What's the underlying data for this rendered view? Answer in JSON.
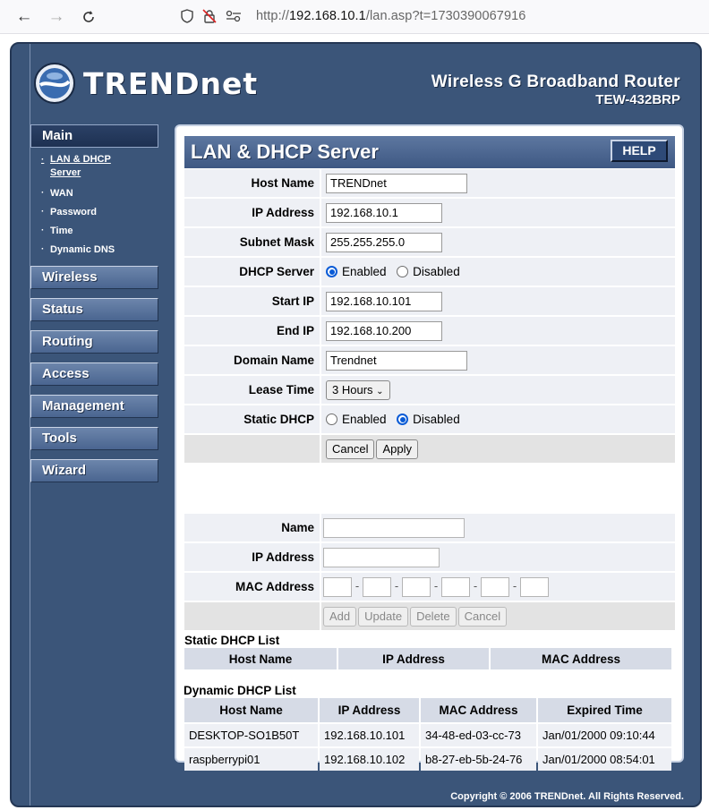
{
  "browser": {
    "url_host": "192.168.10.1",
    "url_path": "/lan.asp?t=1730390067916",
    "url_scheme": "http://"
  },
  "header": {
    "brand": "TRENDnet",
    "product_line": "Wireless G Broadband Router",
    "model": "TEW-432BRP"
  },
  "sidebar": {
    "main_label": "Main",
    "sub_items": [
      {
        "label": "LAN & DHCP Server",
        "active": true
      },
      {
        "label": "WAN"
      },
      {
        "label": "Password"
      },
      {
        "label": "Time"
      },
      {
        "label": "Dynamic DNS"
      }
    ],
    "menus": [
      "Wireless",
      "Status",
      "Routing",
      "Access",
      "Management",
      "Tools",
      "Wizard"
    ]
  },
  "panel": {
    "title": "LAN & DHCP Server",
    "help_label": "HELP"
  },
  "lan_form": {
    "host_name_label": "Host Name",
    "host_name_value": "TRENDnet",
    "ip_label": "IP Address",
    "ip_value": "192.168.10.1",
    "subnet_label": "Subnet Mask",
    "subnet_value": "255.255.255.0",
    "dhcp_label": "DHCP Server",
    "dhcp_enabled": "Enabled",
    "dhcp_disabled": "Disabled",
    "dhcp_state": "Enabled",
    "start_label": "Start IP",
    "start_value": "192.168.10.101",
    "end_label": "End IP",
    "end_value": "192.168.10.200",
    "domain_label": "Domain Name",
    "domain_value": "Trendnet",
    "lease_label": "Lease Time",
    "lease_value": "3 Hours",
    "static_label": "Static DHCP",
    "static_enabled": "Enabled",
    "static_disabled": "Disabled",
    "static_state": "Disabled",
    "cancel_label": "Cancel",
    "apply_label": "Apply"
  },
  "static_form": {
    "name_label": "Name",
    "name_value": "",
    "ip_label": "IP Address",
    "ip_value": "",
    "mac_label": "MAC Address",
    "add_label": "Add",
    "update_label": "Update",
    "delete_label": "Delete",
    "cancel_label": "Cancel"
  },
  "static_list": {
    "title": "Static DHCP List",
    "columns": [
      "Host Name",
      "IP Address",
      "MAC Address"
    ]
  },
  "dynamic_list": {
    "title": "Dynamic DHCP List",
    "columns": [
      "Host Name",
      "IP Address",
      "MAC Address",
      "Expired Time"
    ],
    "rows": [
      [
        "DESKTOP-SO1B50T",
        "192.168.10.101",
        "34-48-ed-03-cc-73",
        "Jan/01/2000 09:10:44"
      ],
      [
        "raspberrypi01",
        "192.168.10.102",
        "b8-27-eb-5b-24-76",
        "Jan/01/2000 08:54:01"
      ]
    ]
  },
  "footer": {
    "copyright": "Copyright © 2006 TRENDnet. All Rights Reserved."
  },
  "colors": {
    "frame": "#3b5579",
    "title_bar": "#4c678f",
    "radio_selected": "#0a5bd6"
  }
}
